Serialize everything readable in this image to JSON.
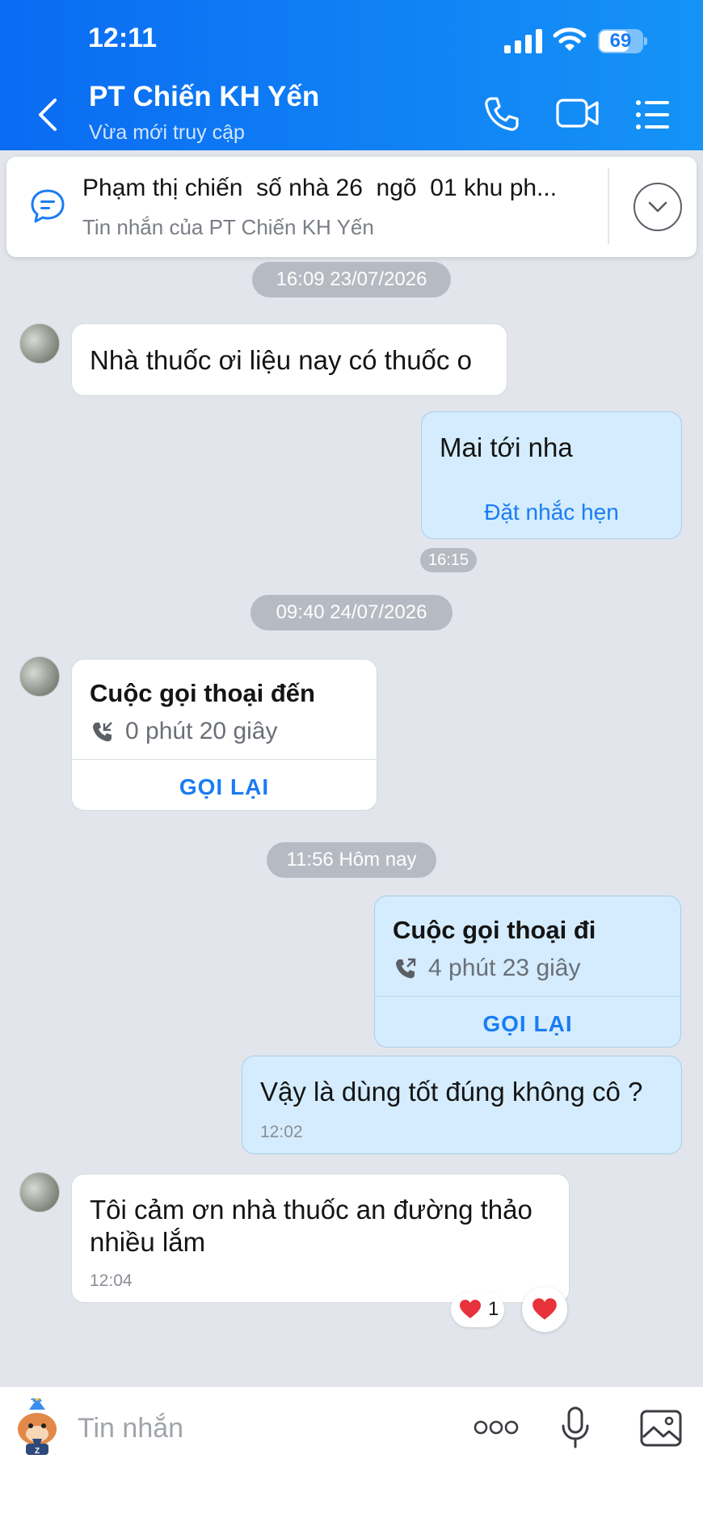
{
  "status_bar": {
    "time": "12:11",
    "battery": "69",
    "battery_level": 0.69
  },
  "header": {
    "contact_name": "PT Chiến KH Yến",
    "contact_status": "Vừa mới truy cập",
    "icons": [
      "back-chevron-icon",
      "phone-icon",
      "video-camera-icon",
      "menu-list-icon"
    ]
  },
  "pinned": {
    "text": "Phạm thị chiến  số nhà 26  ngõ  01 khu ph...",
    "subtitle": "Tin nhắn của PT Chiến KH Yến",
    "icons": [
      "chat-bubble-icon",
      "chevron-down-icon"
    ]
  },
  "conversation": {
    "date_chip_1": "16:09 23/07/2026",
    "msg_1": {
      "text": "Nhà thuốc ơi liệu nay có thuốc o"
    },
    "msg_2": {
      "text": "Mai tới nha",
      "action": "Đặt nhắc hẹn",
      "time": "16:15"
    },
    "date_chip_2": "09:40 24/07/2026",
    "call_in": {
      "title": "Cuộc gọi thoại đến",
      "duration": "0 phút 20 giây",
      "action": "GỌI LẠI"
    },
    "date_chip_3": "11:56 Hôm nay",
    "call_out": {
      "title": "Cuộc gọi thoại đi",
      "duration": "4 phút 23 giây",
      "action": "GỌI LẠI"
    },
    "msg_3": {
      "text": "Vậy là dùng tốt đúng không cô ?",
      "time": "12:02"
    },
    "msg_4": {
      "text_line1": "Tôi cảm ơn nhà thuốc an đường thảo",
      "text_line2": "nhiều lắm",
      "time": "12:04",
      "reaction_count": "1"
    }
  },
  "input_bar": {
    "placeholder": "Tin nhắn",
    "icons": [
      "sticker-icon",
      "more-options-icon",
      "microphone-icon",
      "image-icon"
    ]
  },
  "colors": {
    "header_start": "#0a6bf2",
    "header_end": "#1593f7",
    "accent": "#1a7cf5",
    "out_bubble": "#d4ecfd",
    "chat_bg": "#e2e5ec"
  }
}
